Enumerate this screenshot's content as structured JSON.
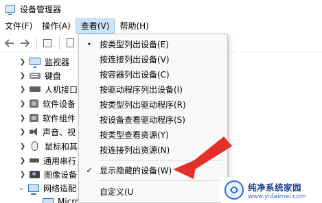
{
  "window": {
    "title": "设备管理器"
  },
  "menubar": {
    "items": [
      {
        "label": "文件(F)"
      },
      {
        "label": "操作(A)"
      },
      {
        "label": "查看(V)"
      },
      {
        "label": "帮助(H)"
      }
    ]
  },
  "toolbar": {
    "icons": [
      "back-arrow-icon",
      "forward-arrow-icon",
      "properties-icon",
      "document-icon"
    ]
  },
  "tree": {
    "items": [
      {
        "label": "监视器",
        "icon": "monitor-icon"
      },
      {
        "label": "键盘",
        "icon": "keyboard-icon"
      },
      {
        "label": "人机接口",
        "icon": "hid-icon"
      },
      {
        "label": "软件设备",
        "icon": "chip-icon"
      },
      {
        "label": "软件组件",
        "icon": "chip-icon"
      },
      {
        "label": "声音、视",
        "icon": "speaker-icon"
      },
      {
        "label": "鼠标和其",
        "icon": "mouse-icon"
      },
      {
        "label": "通用串行",
        "icon": "usb-icon"
      },
      {
        "label": "图像设备",
        "icon": "camera-icon"
      },
      {
        "label": "网络适配",
        "icon": "network-adapter-icon"
      },
      {
        "label": "Microsoft Kernel D",
        "icon": "network-adapter-icon"
      }
    ]
  },
  "view_menu": {
    "items": [
      {
        "label": "按类型列出设备(E)",
        "mark": "•"
      },
      {
        "label": "按连接列出设备(V)",
        "mark": ""
      },
      {
        "label": "按容器列出设备(C)",
        "mark": ""
      },
      {
        "label": "按驱动程序列出设备(I)",
        "mark": ""
      },
      {
        "label": "按类型列出驱动程序(R)",
        "mark": ""
      },
      {
        "label": "按设备查看驱动程序(S)",
        "mark": ""
      },
      {
        "label": "按类型查看资源(Y)",
        "mark": ""
      },
      {
        "label": "按连接列出资源(N)",
        "mark": ""
      },
      {
        "label": "显示隐藏的设备(W)",
        "mark": "✓"
      },
      {
        "label": "自定义(U",
        "mark": ""
      }
    ]
  },
  "watermark": {
    "name": "纯净系统家园",
    "url": "www.yidaimei.com"
  },
  "colors": {
    "menu_active": "#cce4f7",
    "arrow": "#e5302a",
    "watermark_blue": "#1a3c8c"
  }
}
